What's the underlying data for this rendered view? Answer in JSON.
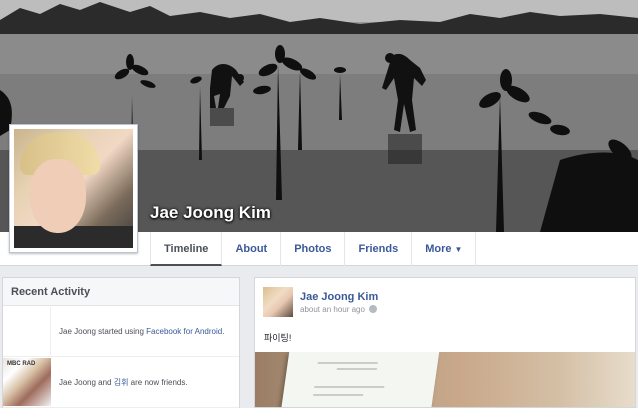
{
  "profile": {
    "name": "Jae Joong Kim"
  },
  "nav": {
    "tabs": [
      {
        "label": "Timeline",
        "active": true
      },
      {
        "label": "About"
      },
      {
        "label": "Photos"
      },
      {
        "label": "Friends"
      },
      {
        "label": "More"
      }
    ]
  },
  "recent_activity": {
    "title": "Recent Activity",
    "items": [
      {
        "pre": "Jae Joong started using ",
        "link1": "Facebook for Android",
        "post": "."
      },
      {
        "pre": "Jae Joong and ",
        "link1": "김휘",
        "post": " are now friends."
      }
    ]
  },
  "post": {
    "author": "Jae Joong Kim",
    "time": "about an hour ago",
    "message": "파이팅!"
  }
}
